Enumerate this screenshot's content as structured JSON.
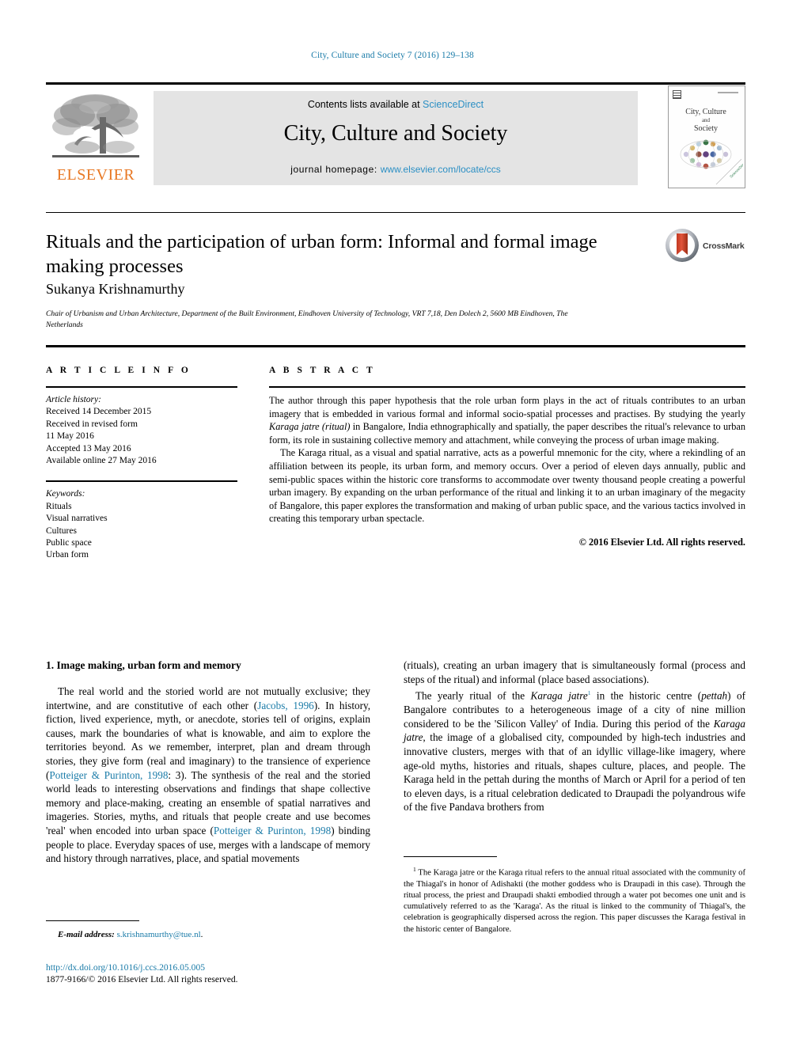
{
  "running_head": "City, Culture and Society 7 (2016) 129–138",
  "masthead": {
    "publisher_name": "ELSEVIER",
    "publisher_logo_name": "elsevier-tree-logo",
    "contents_prefix": "Contents lists available at ",
    "contents_link": "ScienceDirect",
    "journal_name": "City, Culture and Society",
    "homepage_label": "journal homepage: ",
    "homepage_url": "www.elsevier.com/locate/ccs",
    "cover_title_line1": "City, Culture",
    "cover_title_line2": "and",
    "cover_title_line3": "Society"
  },
  "title": "Rituals and the participation of urban form: Informal and formal image making processes",
  "crossmark": {
    "label": "CrossMark",
    "icon": "crossmark-badge-icon"
  },
  "author": "Sukanya Krishnamurthy",
  "affiliation": "Chair of Urbanism and Urban Architecture, Department of the Built Environment, Eindhoven University of Technology, VRT 7,18, Den Dolech 2, 5600 MB Eindhoven, The Netherlands",
  "article_info": {
    "heading": "A R T I C L E   I N F O",
    "history_label": "Article history:",
    "history": [
      "Received 14 December 2015",
      "Received in revised form",
      "11 May 2016",
      "Accepted 13 May 2016",
      "Available online 27 May 2016"
    ],
    "keywords_label": "Keywords:",
    "keywords": [
      "Rituals",
      "Visual narratives",
      "Cultures",
      "Public space",
      "Urban form"
    ]
  },
  "abstract": {
    "heading": "A B S T R A C T",
    "paragraph1_a": "The author through this paper hypothesis that the role urban form plays in the act of rituals contributes to an urban imagery that is embedded in various formal and informal socio-spatial processes and practises. By studying the yearly ",
    "paragraph1_italic": "Karaga jatre (ritual)",
    "paragraph1_b": " in Bangalore, India ethnographically and spatially, the paper describes the ritual's relevance to urban form, its role in sustaining collective memory and attachment, while conveying the process of urban image making.",
    "paragraph2": "The Karaga ritual, as a visual and spatial narrative, acts as a powerful mnemonic for the city, where a rekindling of an affiliation between its people, its urban form, and memory occurs. Over a period of eleven days annually, public and semi-public spaces within the historic core transforms to accommodate over twenty thousand people creating a powerful urban imagery. By expanding on the urban performance of the ritual and linking it to an urban imaginary of the megacity of Bangalore, this paper explores the transformation and making of urban public space, and the various tactics involved in creating this temporary urban spectacle.",
    "copyright": "© 2016 Elsevier Ltd. All rights reserved."
  },
  "body": {
    "section_title": "1. Image making, urban form and memory",
    "left_p1_a": "The real world and the storied world are not mutually exclusive; they intertwine, and are constitutive of each other (",
    "left_p1_cite1": "Jacobs, 1996",
    "left_p1_b": "). In history, fiction, lived experience, myth, or anecdote, stories tell of origins, explain causes, mark the boundaries of what is knowable, and aim to explore the territories beyond. As we remember, interpret, plan and dream through stories, they give form (real and imaginary) to the transience of experience (",
    "left_p1_cite2": "Potteiger & Purinton, 1998",
    "left_p1_c": ": 3). The synthesis of the real and the storied world leads to interesting observations and findings that shape collective memory and place-making, creating an ensemble of spatial narratives and imageries. Stories, myths, and rituals that people create and use becomes 'real' when encoded into urban space (",
    "left_p1_cite3": "Potteiger & Purinton, 1998",
    "left_p1_d": ") binding people to place. Everyday spaces of use, merges with a landscape of memory and history through narratives, place, and spatial movements",
    "right_p1": "(rituals), creating an urban imagery that is simultaneously formal (process and steps of the ritual) and informal (place based associations).",
    "right_p2_a": "The yearly ritual of the ",
    "right_p2_italic1": "Karaga jatre",
    "right_p2_sup": "1",
    "right_p2_b": " in the historic centre (",
    "right_p2_italic2": "pettah",
    "right_p2_c": ") of Bangalore contributes to a heterogeneous image of a city of nine million considered to be the 'Silicon Valley' of India. During this period of the ",
    "right_p2_italic3": "Karaga jatre",
    "right_p2_d": ", the image of a globalised city, compounded by high-tech industries and innovative clusters, merges with that of an idyllic village-like imagery, where age-old myths, histories and rituals, shapes culture, places, and people. The Karaga held in the pettah during the months of March or April for a period of ten to eleven days, is a ritual celebration dedicated to Draupadi the polyandrous wife of the five Pandava brothers from"
  },
  "footnotes": {
    "email_label": "E-mail address:",
    "email_value": "s.krishnamurthy@tue.nl",
    "note_mark": "1",
    "note_text": "The Karaga jatre or the Karaga ritual refers to the annual ritual associated with the community of the Thiagal's in honor of Adishakti (the mother goddess who is Draupadi in this case). Through the ritual process, the priest and Draupadi shakti embodied through a water pot becomes one unit and is cumulatively referred to as the 'Karaga'. As the ritual is linked to the community of Thiagal's, the celebration is geographically dispersed across the region. This paper discusses the Karaga festival in the historic center of Bangalore."
  },
  "footer": {
    "doi": "http://dx.doi.org/10.1016/j.ccs.2016.05.005",
    "issn_line": "1877-9166/© 2016 Elsevier Ltd. All rights reserved."
  },
  "colors": {
    "link_blue": "#1a7ba8",
    "science_direct_blue": "#2b8fc4",
    "elsevier_orange": "#E87722",
    "banner_grey": "#e4e4e4"
  }
}
